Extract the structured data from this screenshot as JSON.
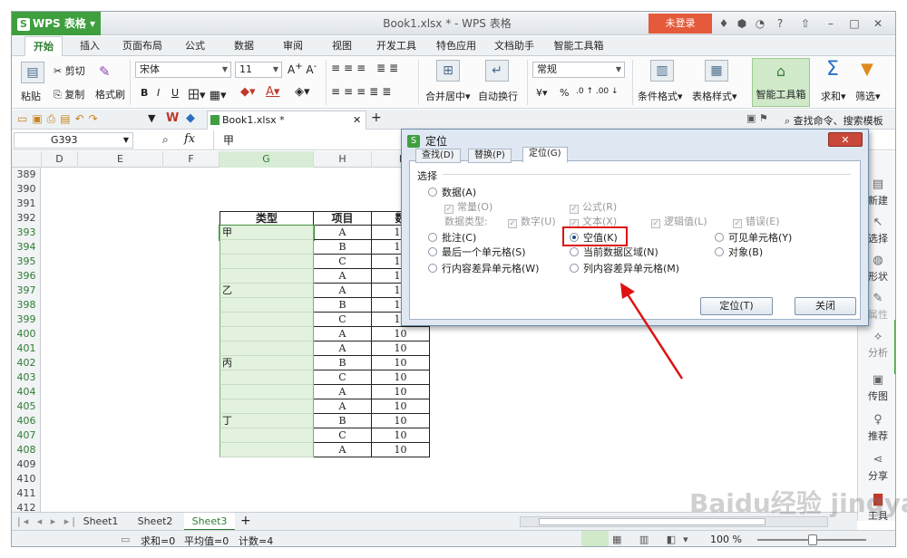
{
  "titlebar": {
    "app_name": "WPS 表格",
    "app_logo": "S",
    "window_title": "Book1.xlsx * - WPS 表格",
    "login_label": "未登录"
  },
  "ribbon_tabs": [
    "开始",
    "插入",
    "页面布局",
    "公式",
    "数据",
    "审阅",
    "视图",
    "开发工具",
    "特色应用",
    "文档助手",
    "智能工具箱"
  ],
  "ribbon": {
    "paste": "粘贴",
    "cut": "剪切",
    "copy": "复制",
    "format_painter": "格式刷",
    "font_name": "宋体",
    "font_size": "11",
    "merge_center": "合并居中",
    "wrap_text": "自动换行",
    "number_format": "常规",
    "percent": "%",
    "conditional_format": "条件格式",
    "table_style": "表格样式",
    "smart_toolbox": "智能工具箱",
    "sum": "求和",
    "filter": "筛选"
  },
  "qat": {
    "doc_tab": "Book1.xlsx *",
    "search": "查找命令、搜索模板"
  },
  "formula_bar": {
    "name_box": "G393",
    "fx": "fx",
    "content": "甲"
  },
  "columns": [
    "D",
    "E",
    "F",
    "G",
    "H",
    "I"
  ],
  "rows": [
    "389",
    "390",
    "391",
    "392",
    "393",
    "394",
    "395",
    "396",
    "397",
    "398",
    "399",
    "400",
    "401",
    "402",
    "403",
    "404",
    "405",
    "406",
    "407",
    "408",
    "409",
    "410",
    "411",
    "412"
  ],
  "table": {
    "headers": [
      "类型",
      "项目",
      "数"
    ],
    "type_col": [
      "甲",
      "",
      "",
      "",
      "乙",
      "",
      "",
      "",
      "",
      "丙",
      "",
      "",
      "",
      "丁",
      "",
      ""
    ],
    "item_col": [
      "A",
      "B",
      "C",
      "A",
      "A",
      "B",
      "C",
      "A",
      "A",
      "B",
      "C",
      "A",
      "A",
      "B",
      "C",
      "A"
    ],
    "num_col": [
      "10",
      "10",
      "10",
      "10",
      "10",
      "10",
      "10",
      "10",
      "10",
      "10",
      "10",
      "10",
      "10",
      "10",
      "10",
      "10"
    ]
  },
  "sidebar": [
    "新建",
    "选择",
    "形状",
    "属性",
    "分析",
    "传图",
    "推荐",
    "分享",
    "工具"
  ],
  "sheets": [
    "Sheet1",
    "Sheet2",
    "Sheet3"
  ],
  "status": {
    "sum": "求和=0",
    "avg": "平均值=0",
    "count": "计数=4",
    "zoom": "100 %"
  },
  "dialog": {
    "title": "定位",
    "logo": "S",
    "tabs": [
      "查找(D)",
      "替换(P)",
      "定位(G)"
    ],
    "group_label": "选择",
    "opt_data": "数据(A)",
    "opt_const": "常量(O)",
    "opt_formula": "公式(R)",
    "data_type_label": "数据类型:",
    "chk_number": "数字(U)",
    "chk_text": "文本(X)",
    "chk_logical": "逻辑值(L)",
    "chk_error": "错误(E)",
    "opt_comment": "批注(C)",
    "opt_blank": "空值(K)",
    "opt_visible": "可见单元格(Y)",
    "opt_last": "最后一个单元格(S)",
    "opt_region": "当前数据区域(N)",
    "opt_object": "对象(B)",
    "opt_rowdiff": "行内容差异单元格(W)",
    "opt_coldiff": "列内容差异单元格(M)",
    "btn_locate": "定位(T)",
    "btn_close": "关闭"
  },
  "watermark": "Baidu经验  jingyan.baidu.com"
}
